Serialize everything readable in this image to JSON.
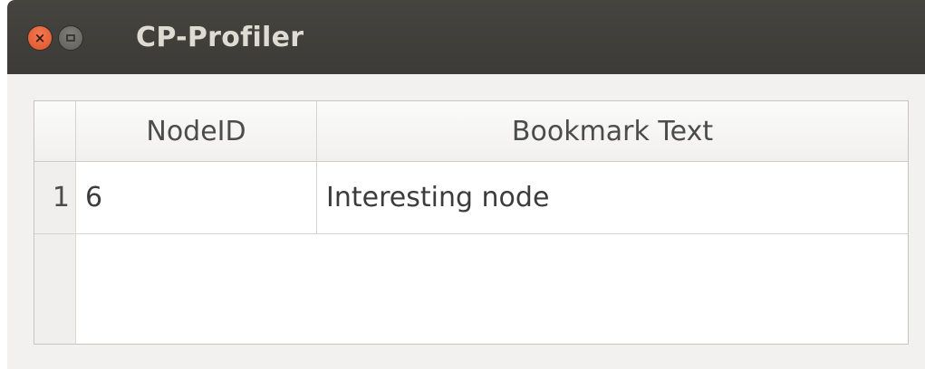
{
  "window": {
    "title": "CP-Profiler",
    "close_glyph": "×",
    "close_icon": "close-icon",
    "maximize_icon": "maximize-icon"
  },
  "table": {
    "columns": [
      "NodeID",
      "Bookmark Text"
    ],
    "rows": [
      {
        "row_number": "1",
        "node_id": "6",
        "bookmark_text": "Interesting node"
      }
    ]
  },
  "colors": {
    "titlebar": "#3c3b37",
    "title_text": "#dfdbd2",
    "close_button": "#e0532a",
    "window_background": "#f2f1f0"
  }
}
